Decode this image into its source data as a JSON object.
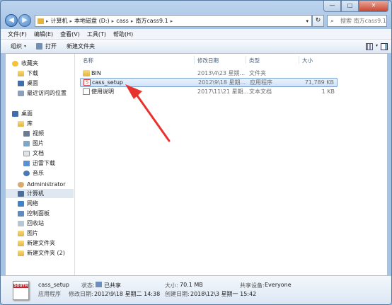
{
  "nav": {
    "back": "◀",
    "forward": "▶",
    "dropdown": "▾"
  },
  "address": {
    "parts": [
      "计算机",
      "本地磁盘 (D:)",
      "cass",
      "南方cass9.1"
    ],
    "sep": "▸"
  },
  "refresh_glyph": "↻",
  "search": {
    "placeholder": "搜索 南方cass9.1"
  },
  "window_controls": {
    "min": "—",
    "max": "□",
    "close": "✕"
  },
  "menu": [
    "文件(F)",
    "编辑(E)",
    "查看(V)",
    "工具(T)",
    "帮助(H)"
  ],
  "toolbar": {
    "organize": "组织",
    "open": "打开",
    "new_folder": "新建文件夹"
  },
  "sidebar": {
    "favorites": "收藏夹",
    "downloads": "下载",
    "desktop_fav": "桌面",
    "recent": "最近访问的位置",
    "desktop": "桌面",
    "libraries": "库",
    "video": "视频",
    "pictures": "图片",
    "documents": "文档",
    "thunder": "迅雷下载",
    "music": "音乐",
    "admin": "Administrator",
    "computer": "计算机",
    "network": "网络",
    "control_panel": "控制面板",
    "recycle": "回收站",
    "pics2": "图片",
    "newfolder": "新建文件夹",
    "newfolder2": "新建文件夹 (2)"
  },
  "columns": {
    "name": "名称",
    "date": "修改日期",
    "type": "类型",
    "size": "大小"
  },
  "files": [
    {
      "name": "BIN",
      "date": "2013\\4\\23 星期...",
      "type": "文件夹",
      "size": ""
    },
    {
      "name": "cass_setup",
      "date": "2012\\9\\18 星期...",
      "type": "应用程序",
      "size": "71,789 KB"
    },
    {
      "name": "使用说明",
      "date": "2017\\11\\21 星期...",
      "type": "文本文档",
      "size": "1 KB"
    }
  ],
  "status": {
    "filename": "cass_setup",
    "filetype": "应用程序",
    "state_label": "状态:",
    "state_value": "已共享",
    "size_label": "大小:",
    "size_value": "70.1 MB",
    "share_label": "共享设备:",
    "share_value": "Everyone",
    "modified_label": "修改日期:",
    "modified_value": "2012\\9\\18 星期二 14:38",
    "created_label": "创建日期:",
    "created_value": "2018\\12\\3 星期一 15:42",
    "icon_text": "SOUTH"
  },
  "colors": {
    "accent": "#3f78bf",
    "selection": "#cfe3fa",
    "arrow": "#e8322e"
  }
}
